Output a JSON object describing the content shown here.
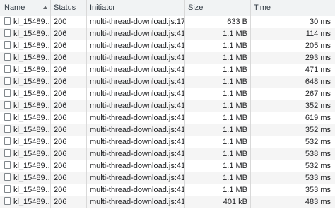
{
  "columns": {
    "name": "Name",
    "status": "Status",
    "initiator": "Initiator",
    "size": "Size",
    "time": "Time"
  },
  "rows": [
    {
      "name": "kl_15489…",
      "status": "200",
      "initiator": "multi-thread-download.js:17",
      "size": "633 B",
      "time": "30 ms"
    },
    {
      "name": "kl_15489…",
      "status": "206",
      "initiator": "multi-thread-download.js:41",
      "size": "1.1 MB",
      "time": "114 ms"
    },
    {
      "name": "kl_15489…",
      "status": "206",
      "initiator": "multi-thread-download.js:41",
      "size": "1.1 MB",
      "time": "205 ms"
    },
    {
      "name": "kl_15489…",
      "status": "206",
      "initiator": "multi-thread-download.js:41",
      "size": "1.1 MB",
      "time": "293 ms"
    },
    {
      "name": "kl_15489…",
      "status": "206",
      "initiator": "multi-thread-download.js:41",
      "size": "1.1 MB",
      "time": "471 ms"
    },
    {
      "name": "kl_15489…",
      "status": "206",
      "initiator": "multi-thread-download.js:41",
      "size": "1.1 MB",
      "time": "648 ms"
    },
    {
      "name": "kl_15489…",
      "status": "206",
      "initiator": "multi-thread-download.js:41",
      "size": "1.1 MB",
      "time": "267 ms"
    },
    {
      "name": "kl_15489…",
      "status": "206",
      "initiator": "multi-thread-download.js:41",
      "size": "1.1 MB",
      "time": "352 ms"
    },
    {
      "name": "kl_15489…",
      "status": "206",
      "initiator": "multi-thread-download.js:41",
      "size": "1.1 MB",
      "time": "619 ms"
    },
    {
      "name": "kl_15489…",
      "status": "206",
      "initiator": "multi-thread-download.js:41",
      "size": "1.1 MB",
      "time": "352 ms"
    },
    {
      "name": "kl_15489…",
      "status": "206",
      "initiator": "multi-thread-download.js:41",
      "size": "1.1 MB",
      "time": "532 ms"
    },
    {
      "name": "kl_15489…",
      "status": "206",
      "initiator": "multi-thread-download.js:41",
      "size": "1.1 MB",
      "time": "538 ms"
    },
    {
      "name": "kl_15489…",
      "status": "206",
      "initiator": "multi-thread-download.js:41",
      "size": "1.1 MB",
      "time": "532 ms"
    },
    {
      "name": "kl_15489…",
      "status": "206",
      "initiator": "multi-thread-download.js:41",
      "size": "1.1 MB",
      "time": "533 ms"
    },
    {
      "name": "kl_15489…",
      "status": "206",
      "initiator": "multi-thread-download.js:41",
      "size": "1.1 MB",
      "time": "353 ms"
    },
    {
      "name": "kl_15489…",
      "status": "206",
      "initiator": "multi-thread-download.js:41",
      "size": "401 kB",
      "time": "483 ms"
    }
  ]
}
